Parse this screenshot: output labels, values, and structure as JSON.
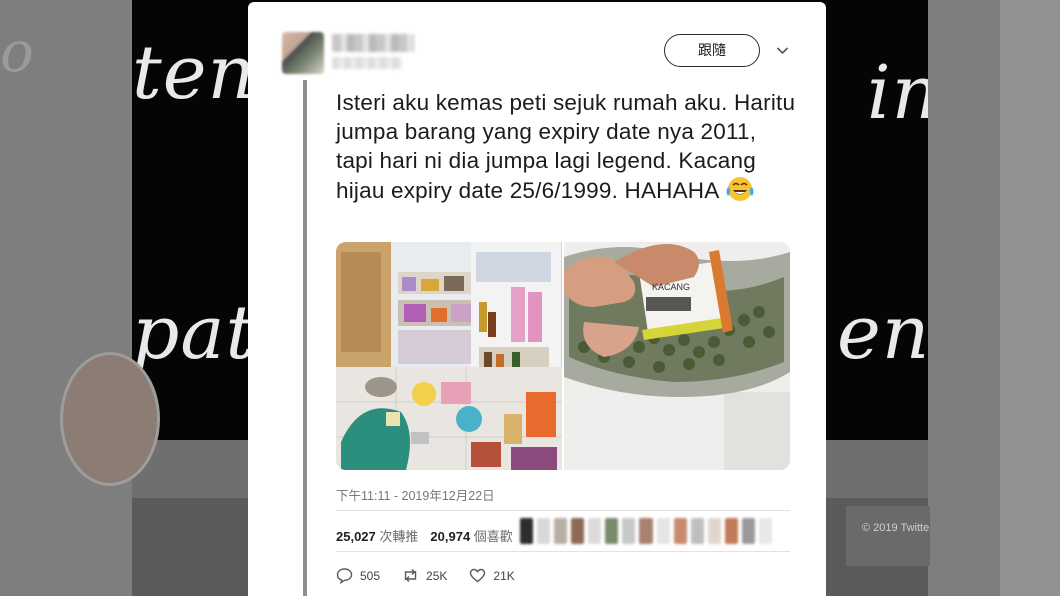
{
  "background": {
    "left_blur_text": "o",
    "hero_words": [
      {
        "text": "ten"
      },
      {
        "text": "in"
      },
      {
        "text": "pat"
      },
      {
        "text": "en"
      }
    ],
    "footer": "© 2019 Twitte"
  },
  "tweet": {
    "follow_label": "跟隨",
    "text": "Isteri aku kemas peti sejuk rumah aku. Haritu jumpa barang yang expiry date nya 2011, tapi hari ni dia jumpa lagi legend. Kacang hijau expiry date 25/6/1999. HAHAHA",
    "emoji_name": "face-with-tears-of-joy-icon",
    "timestamp": "下午11:11 - 2019年12月22日",
    "retweets_count": "25,027",
    "retweets_label": "次轉推",
    "likes_count": "20,974",
    "likes_label": "個喜歡",
    "actions": {
      "reply_count": "505",
      "retweet_count": "25K",
      "like_count": "21K"
    },
    "photo_packet_label": "KACANG"
  },
  "colors": {
    "card": "#ffffff",
    "text": "#1c1c1c",
    "muted": "#777777",
    "backdrop": "#6b6b6b"
  }
}
